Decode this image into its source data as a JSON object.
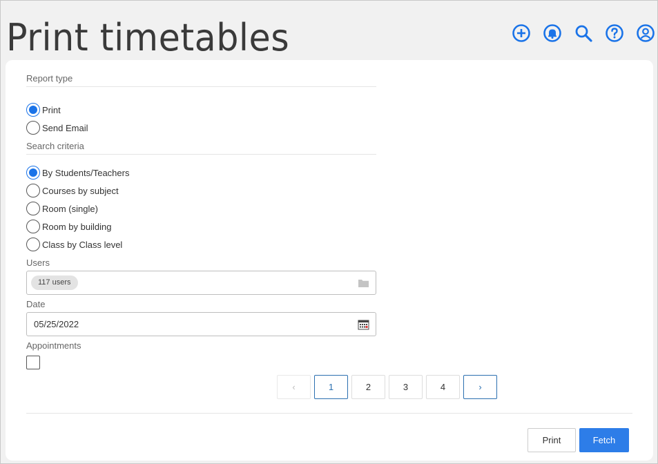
{
  "header": {
    "title": "Print timetables",
    "icons": [
      "add-circle-icon",
      "bell-icon",
      "search-icon",
      "help-icon",
      "account-icon"
    ],
    "accent_color": "#1a73e8"
  },
  "report_type": {
    "label": "Report type",
    "options": [
      {
        "label": "Print",
        "checked": true
      },
      {
        "label": "Send Email",
        "checked": false
      }
    ]
  },
  "search_criteria": {
    "label": "Search criteria",
    "options": [
      {
        "label": "By Students/Teachers",
        "checked": true
      },
      {
        "label": "Courses by subject",
        "checked": false
      },
      {
        "label": "Room (single)",
        "checked": false
      },
      {
        "label": "Room by building",
        "checked": false
      },
      {
        "label": "Class by Class level",
        "checked": false
      }
    ]
  },
  "users": {
    "label": "Users",
    "chip": "117 users"
  },
  "date": {
    "label": "Date",
    "value": "05/25/2022"
  },
  "appointments": {
    "label": "Appointments",
    "checked": false
  },
  "pagination": {
    "prev": "‹",
    "pages": [
      "1",
      "2",
      "3",
      "4"
    ],
    "active": "1",
    "next": "›"
  },
  "actions": {
    "print_label": "Print",
    "fetch_label": "Fetch"
  }
}
